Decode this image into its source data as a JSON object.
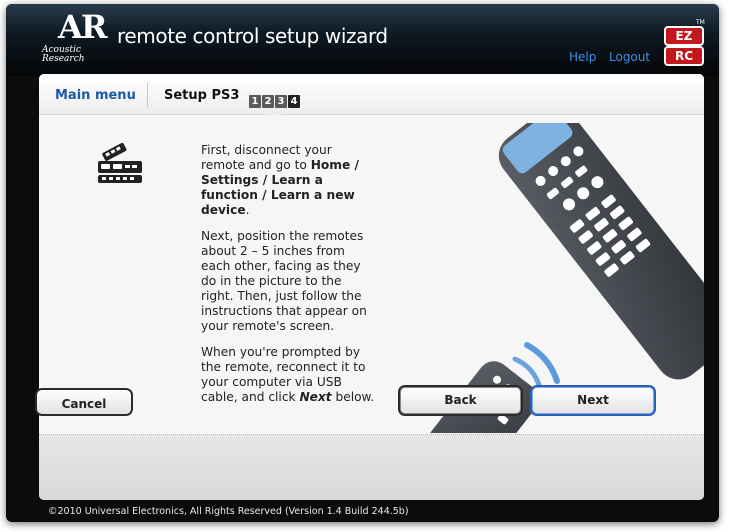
{
  "header": {
    "logo_initials": "AR",
    "logo_wordmark": "Acoustic Research",
    "app_title": "remote control setup wizard",
    "help_label": "Help",
    "logout_label": "Logout",
    "badge_top": "EZ",
    "badge_bottom": "RC",
    "badge_tm": "TM"
  },
  "tabs": {
    "main_menu": "Main menu",
    "setup": "Setup PS3",
    "steps": [
      "1",
      "2",
      "3",
      "4"
    ],
    "active_step": 4
  },
  "instructions": {
    "p1_a": "First, disconnect your remote and go to ",
    "p1_b": "Home / Settings / Learn a function / Learn a new device",
    "p1_c": ".",
    "p2": "Next, position the remotes about 2 – 5 inches from each other, facing as they do in the picture to the right. Then, just follow the instructions that appear on your remote's screen.",
    "p3_a": "When you're prompted by the remote, reconnect it to your computer via USB cable, and click ",
    "p3_b": "Next",
    "p3_c": " below."
  },
  "buttons": {
    "cancel": "Cancel",
    "back": "Back",
    "next": "Next"
  },
  "footer": {
    "copyright": "©2010 Universal Electronics, All Rights Reserved (Version 1.4 Build 244.5b)"
  },
  "colors": {
    "accent_link": "#3b8ee6",
    "main_menu": "#1a5aa8",
    "badge_red": "#c0181c",
    "next_border": "#2860b8"
  }
}
